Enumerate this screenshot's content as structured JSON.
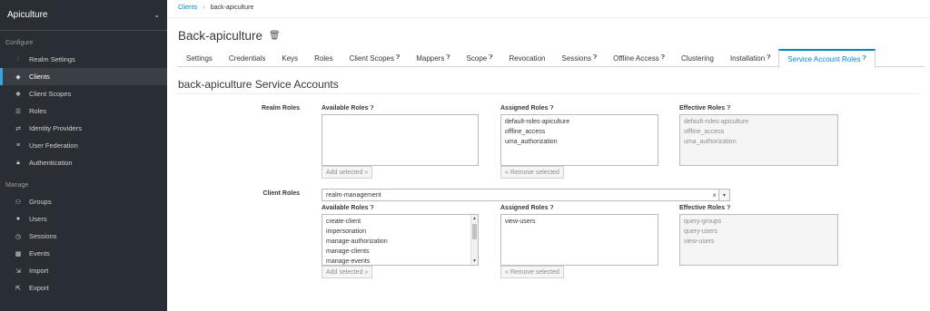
{
  "sidebar": {
    "realm": "Apiculture",
    "configure_label": "Configure",
    "manage_label": "Manage",
    "configure_items": [
      {
        "label": "Realm Settings",
        "icon": "sliders-icon"
      },
      {
        "label": "Clients",
        "icon": "cube-icon"
      },
      {
        "label": "Client Scopes",
        "icon": "cubes-icon"
      },
      {
        "label": "Roles",
        "icon": "list-icon"
      },
      {
        "label": "Identity Providers",
        "icon": "exchange-icon"
      },
      {
        "label": "User Federation",
        "icon": "database-icon"
      },
      {
        "label": "Authentication",
        "icon": "lock-icon"
      }
    ],
    "manage_items": [
      {
        "label": "Groups",
        "icon": "users-icon"
      },
      {
        "label": "Users",
        "icon": "user-icon"
      },
      {
        "label": "Sessions",
        "icon": "clock-icon"
      },
      {
        "label": "Events",
        "icon": "calendar-icon"
      },
      {
        "label": "Import",
        "icon": "import-icon"
      },
      {
        "label": "Export",
        "icon": "export-icon"
      }
    ]
  },
  "breadcrumb": {
    "link": "Clients",
    "current": "back-apiculture"
  },
  "page_title": "Back-apiculture",
  "tabs": [
    {
      "label": "Settings",
      "help": false
    },
    {
      "label": "Credentials",
      "help": false
    },
    {
      "label": "Keys",
      "help": false
    },
    {
      "label": "Roles",
      "help": false
    },
    {
      "label": "Client Scopes",
      "help": true
    },
    {
      "label": "Mappers",
      "help": true
    },
    {
      "label": "Scope",
      "help": true
    },
    {
      "label": "Revocation",
      "help": false
    },
    {
      "label": "Sessions",
      "help": true
    },
    {
      "label": "Offline Access",
      "help": true
    },
    {
      "label": "Clustering",
      "help": false
    },
    {
      "label": "Installation",
      "help": true
    },
    {
      "label": "Service Account Roles",
      "help": true
    }
  ],
  "section_title": "back-apiculture Service Accounts",
  "realm_roles": {
    "label": "Realm Roles",
    "available_label": "Available Roles",
    "assigned_label": "Assigned Roles",
    "effective_label": "Effective Roles",
    "available": [],
    "assigned": [
      "default-roles-apiculture",
      "offline_access",
      "uma_authorization"
    ],
    "effective": [
      "default-roles-apiculture",
      "offline_access",
      "uma_authorization"
    ],
    "add_btn": "Add selected »",
    "remove_btn": "« Remove selected"
  },
  "client_roles": {
    "label": "Client Roles",
    "selected_client": "realm-management",
    "clear": "×",
    "caret": "▾",
    "available_label": "Available Roles",
    "assigned_label": "Assigned Roles",
    "effective_label": "Effective Roles",
    "available": [
      "create-client",
      "impersonation",
      "manage-authorization",
      "manage-clients",
      "manage-events"
    ],
    "assigned": [
      "view-users"
    ],
    "effective": [
      "query-groups",
      "query-users",
      "view-users"
    ],
    "add_btn": "Add selected »",
    "remove_btn": "« Remove selected"
  },
  "help_glyph": "?"
}
